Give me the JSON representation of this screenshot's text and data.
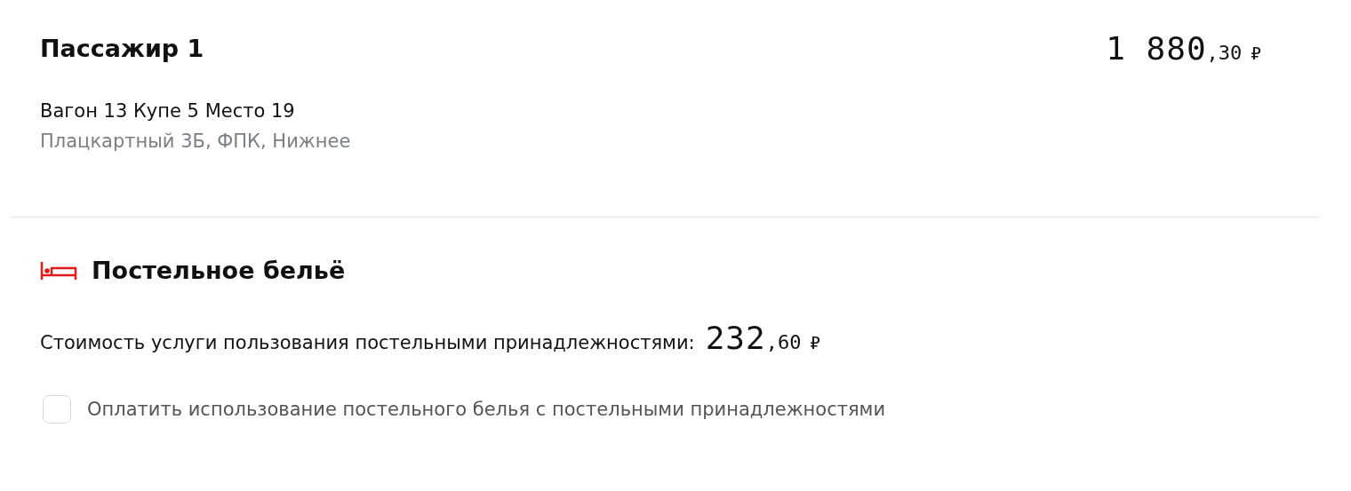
{
  "passenger": {
    "title": "Пассажир 1",
    "price": {
      "whole": "1 880",
      "fraction": ",30",
      "currency": "₽"
    },
    "seat": "Вагон 13 Купе 5 Место 19",
    "details": "Плацкартный 3Б, ФПК, Нижнее"
  },
  "bedding": {
    "title": "Постельное бельё",
    "cost_label": "Стоимость услуги пользования постельными принадлежностями:",
    "price": {
      "whole": "232",
      "fraction": ",60",
      "currency": "₽"
    },
    "checkbox": {
      "label": "Оплатить использование постельного белья с постельными принадлежностями",
      "checked": false
    }
  }
}
